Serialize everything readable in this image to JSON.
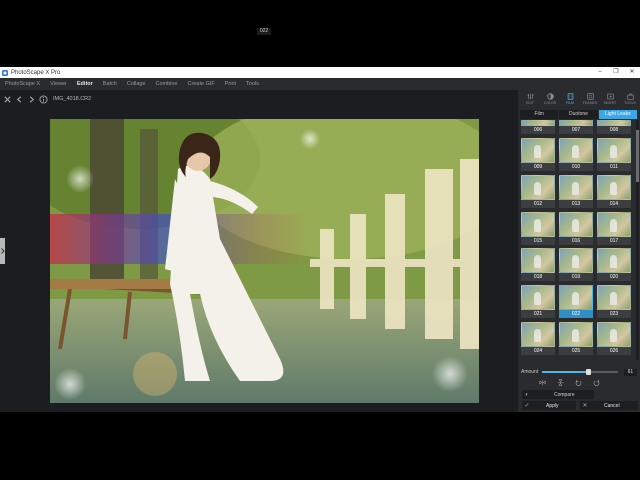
{
  "window": {
    "title": "PhotoScape X Pro",
    "controls": [
      "–",
      "❐",
      "✕"
    ]
  },
  "menu": [
    "PhotoScape X",
    "Viewer",
    "Editor",
    "Batch",
    "Collage",
    "Combine",
    "Create GIF",
    "Print",
    "Tools"
  ],
  "menu_active": "Editor",
  "file": {
    "name": "IMG_4018.CR2",
    "zoom": "022"
  },
  "tools": [
    {
      "label": "EDIT",
      "icon": "sliders-icon"
    },
    {
      "label": "COLOR",
      "icon": "color-circle-icon"
    },
    {
      "label": "FILM",
      "icon": "film-icon"
    },
    {
      "label": "FRAMES",
      "icon": "frame-icon"
    },
    {
      "label": "INSERT",
      "icon": "insert-icon"
    },
    {
      "label": "TOOLS",
      "icon": "toolbox-icon"
    }
  ],
  "active_tool": "FILM",
  "tabs": [
    "Film",
    "Duotone",
    "Light Leaks"
  ],
  "active_tab": "Light Leaks",
  "thumbnails": [
    "006",
    "007",
    "008",
    "009",
    "010",
    "011",
    "012",
    "013",
    "014",
    "015",
    "016",
    "017",
    "018",
    "019",
    "020",
    "021",
    "022",
    "023",
    "024",
    "025",
    "026"
  ],
  "selected_thumbnail": "022",
  "amount": {
    "label": "Amount",
    "value": "61",
    "fraction": 0.61
  },
  "buttons": {
    "compare": "Compare",
    "apply": "Apply",
    "cancel": "Cancel"
  },
  "colors": {
    "accent": "#38a8e6",
    "panel": "#2a2b2e",
    "workspace": "#1c1d20"
  }
}
